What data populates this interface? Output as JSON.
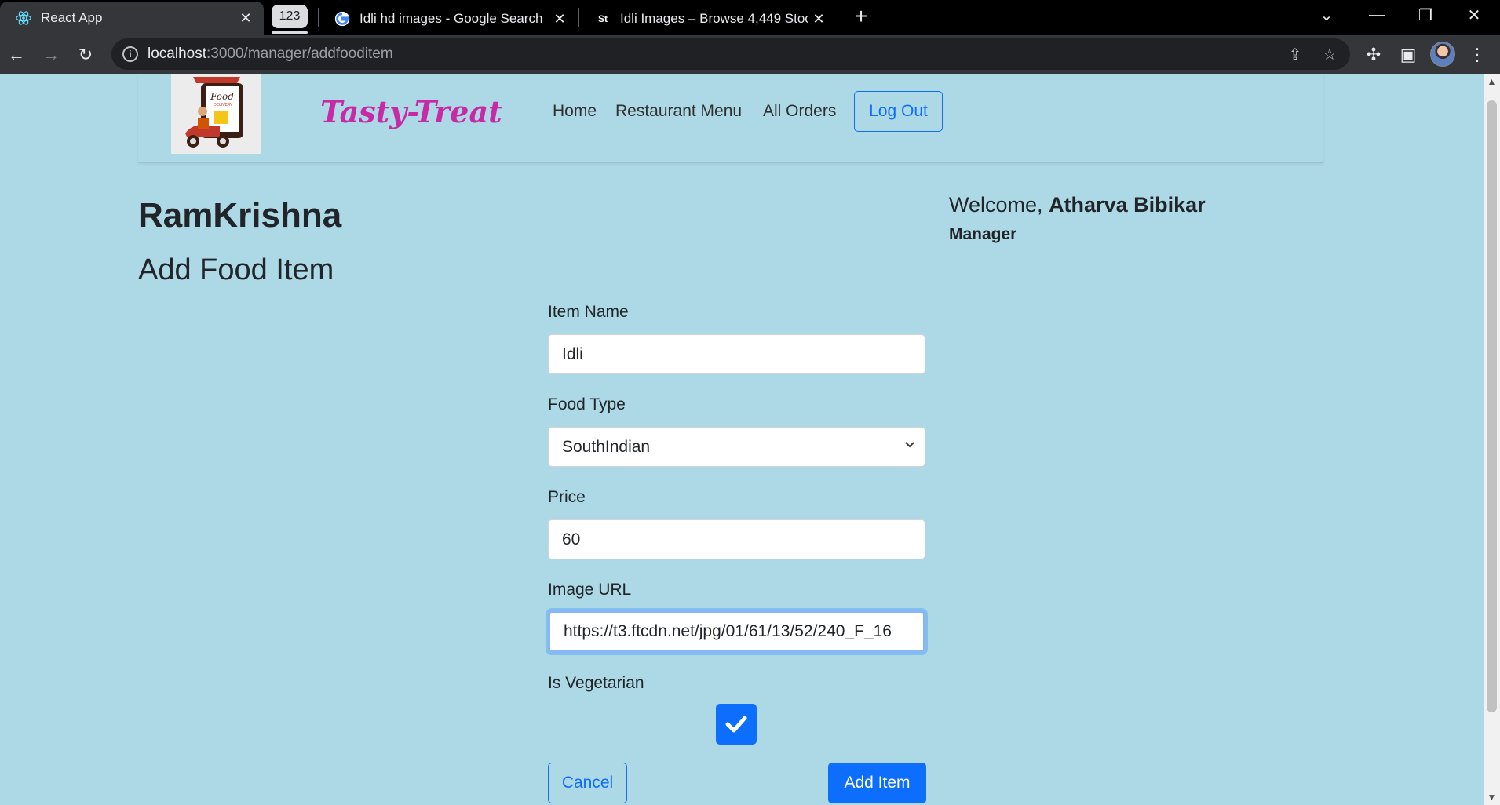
{
  "browser": {
    "tabs": [
      {
        "title": "React App",
        "icon": "react-icon"
      },
      {
        "title": "Idli hd images - Google Search",
        "icon": "google-icon"
      },
      {
        "title": "Idli Images – Browse 4,449 Stock",
        "icon": "stock-icon"
      }
    ],
    "tab_group_label": "123",
    "url_host": "localhost",
    "url_path": ":3000/manager/addfooditem"
  },
  "navbar": {
    "brand": "Tasty-Treat",
    "logo_text": "Food",
    "logo_subtext": "DELIVERY",
    "links": [
      "Home",
      "Restaurant Menu",
      "All Orders"
    ],
    "logout_label": "Log Out"
  },
  "page": {
    "restaurant_name": "RamKrishna",
    "title": "Add Food Item",
    "welcome_prefix": "Welcome,",
    "user_name": "Atharva Bibikar",
    "user_role": "Manager"
  },
  "form": {
    "item_name_label": "Item Name",
    "item_name_value": "Idli",
    "food_type_label": "Food Type",
    "food_type_value": "SouthIndian",
    "price_label": "Price",
    "price_value": "60",
    "image_url_label": "Image URL",
    "image_url_value": "https://t3.ftcdn.net/jpg/01/61/13/52/240_F_16",
    "is_veg_label": "Is Vegetarian",
    "is_veg_checked": true,
    "cancel_label": "Cancel",
    "submit_label": "Add Item"
  },
  "colors": {
    "page_bg": "#add8e6",
    "brand": "#c72aa4",
    "primary": "#0d6efd"
  }
}
